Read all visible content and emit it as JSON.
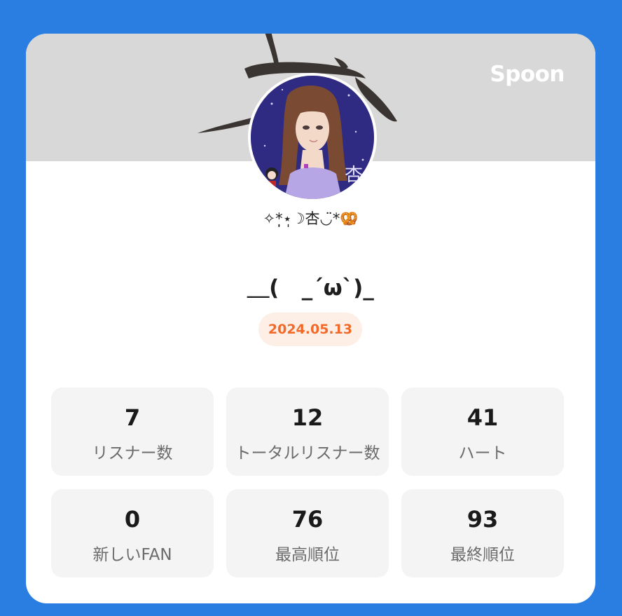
{
  "brand": {
    "logo_text": "Spoon",
    "page_bg_color": "#2a7de1",
    "badge_text_color": "#f26a2a"
  },
  "profile": {
    "nickname": "✧*̣̩⋆̩☽杏◡̈*🥨",
    "avatar_icon": "anime-girl-avatar"
  },
  "live": {
    "title": "＿(   _´ω`)_",
    "date": "2024.05.13"
  },
  "stats": [
    {
      "value": "7",
      "label": "リスナー数"
    },
    {
      "value": "12",
      "label": "トータルリスナー数"
    },
    {
      "value": "41",
      "label": "ハート"
    },
    {
      "value": "0",
      "label": "新しいFAN"
    },
    {
      "value": "76",
      "label": "最高順位"
    },
    {
      "value": "93",
      "label": "最終順位"
    }
  ]
}
